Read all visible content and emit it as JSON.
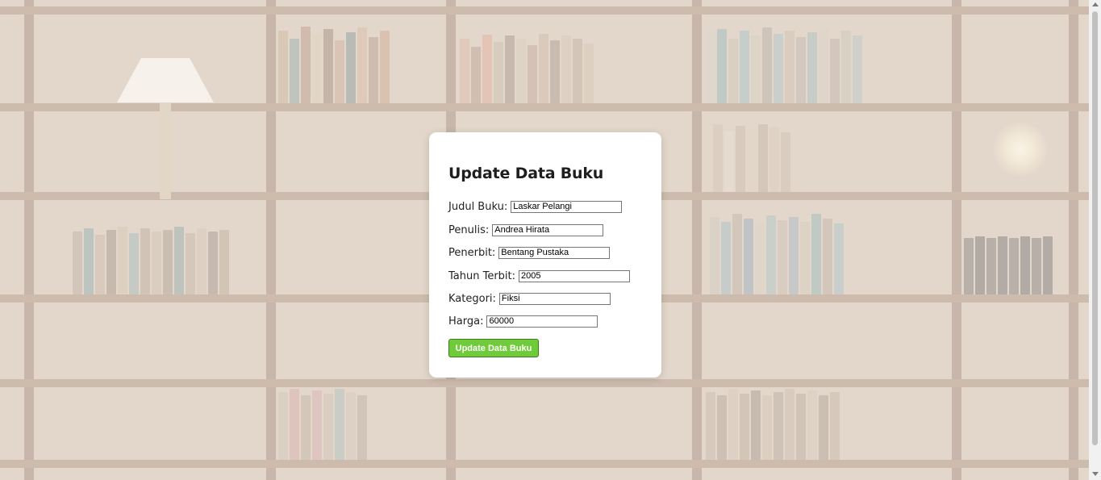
{
  "form": {
    "title": "Update Data Buku",
    "fields": [
      {
        "label": "Judul Buku:",
        "value": "Laskar Pelangi"
      },
      {
        "label": "Penulis:",
        "value": "Andrea Hirata"
      },
      {
        "label": "Penerbit:",
        "value": "Bentang Pustaka"
      },
      {
        "label": "Tahun Terbit:",
        "value": "2005"
      },
      {
        "label": "Kategori:",
        "value": "Fiksi"
      },
      {
        "label": "Harga:",
        "value": "60000"
      }
    ],
    "submit_label": "Update Data Buku"
  },
  "colors": {
    "button": "#6fcb3a",
    "card": "#ffffff",
    "backdrop": "#cbb8a3"
  },
  "icons": {
    "scroll_up": "triangle-up",
    "scroll_down": "triangle-down"
  }
}
